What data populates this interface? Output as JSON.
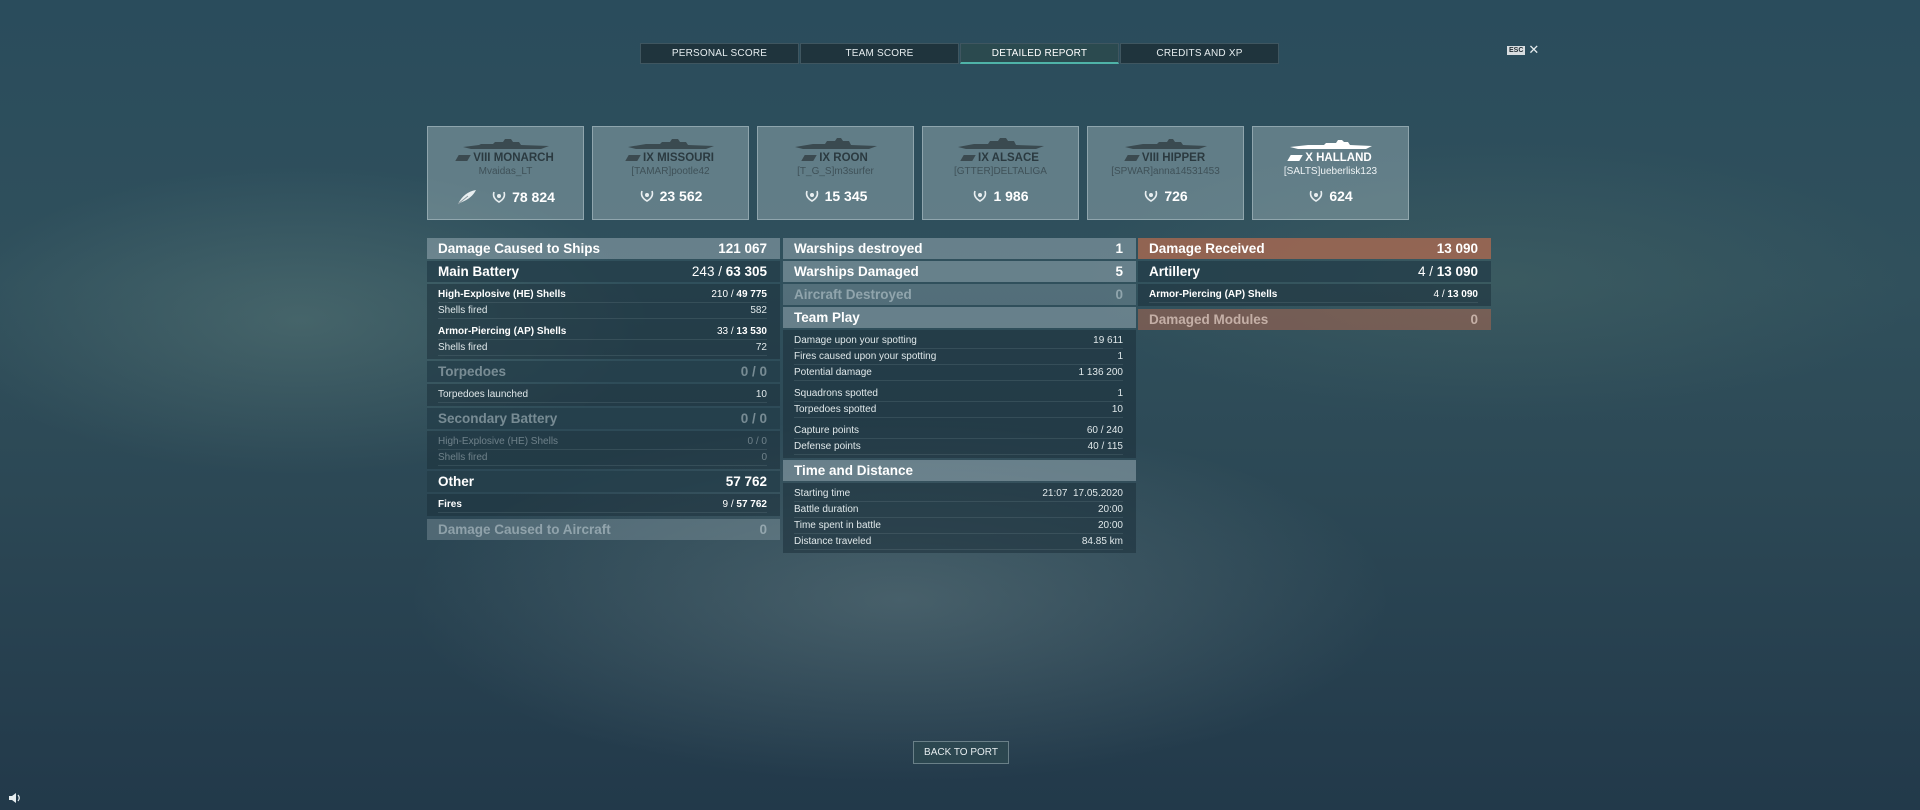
{
  "tabs": [
    {
      "label": "PERSONAL SCORE"
    },
    {
      "label": "TEAM SCORE"
    },
    {
      "label": "DETAILED REPORT"
    },
    {
      "label": "CREDITS AND XP"
    }
  ],
  "esc": {
    "key": "ESC",
    "close": "✕"
  },
  "cards": [
    {
      "ship": "VIII MONARCH",
      "player": "Mvaidas_LT",
      "score": "78 824"
    },
    {
      "ship": "IX MISSOURI",
      "player": "[TAMAR]pootle42",
      "score": "23 562"
    },
    {
      "ship": "IX ROON",
      "player": "[T_G_S]m3surfer",
      "score": "15 345"
    },
    {
      "ship": "IX ALSACE",
      "player": "[GTTER]DELTALIGA",
      "score": "1 986"
    },
    {
      "ship": "VIII HIPPER",
      "player": "[SPWAR]anna14531453",
      "score": "726"
    },
    {
      "ship": "X HALLAND",
      "player": "[SALTS]ueberlisk123",
      "score": "624"
    }
  ],
  "col1": {
    "damage": {
      "label": "Damage Caused to Ships",
      "value": "121 067"
    },
    "main_battery": {
      "label": "Main Battery",
      "hits": "243 / ",
      "total": "63 305"
    },
    "he": {
      "label": "High-Explosive (HE) Shells",
      "hits": "210 / ",
      "total": "49 775",
      "fired_label": "Shells fired",
      "fired": "582"
    },
    "ap": {
      "label": "Armor-Piercing (AP) Shells",
      "hits": "33 / ",
      "total": "13 530",
      "fired_label": "Shells fired",
      "fired": "72"
    },
    "torpedoes": {
      "label": "Torpedoes",
      "value": "0 / 0",
      "launched_label": "Torpedoes launched",
      "launched": "10"
    },
    "secondary": {
      "label": "Secondary Battery",
      "value": "0 / 0",
      "he_label": "High-Explosive (HE) Shells",
      "he_value": "0 / 0",
      "fired_label": "Shells fired",
      "fired": "0"
    },
    "other": {
      "label": "Other",
      "value": "57 762",
      "fires_label": "Fires",
      "fires_hits": "9 / ",
      "fires_total": "57 762"
    },
    "aircraft": {
      "label": "Damage Caused to Aircraft",
      "value": "0"
    }
  },
  "col2": {
    "destroyed": {
      "label": "Warships destroyed",
      "value": "1"
    },
    "damaged": {
      "label": "Warships Damaged",
      "value": "5"
    },
    "aircraft": {
      "label": "Aircraft Destroyed",
      "value": "0"
    },
    "team_play": {
      "label": "Team Play"
    },
    "tp_rows1": [
      {
        "label": "Damage upon your spotting",
        "value": "19 611"
      },
      {
        "label": "Fires caused upon your spotting",
        "value": "1"
      },
      {
        "label": "Potential damage",
        "value": "1 136 200"
      }
    ],
    "tp_rows2": [
      {
        "label": "Squadrons spotted",
        "value": "1"
      },
      {
        "label": "Torpedoes spotted",
        "value": "10"
      }
    ],
    "tp_rows3": [
      {
        "label": "Capture points",
        "value": "60 / 240"
      },
      {
        "label": "Defense points",
        "value": "40 / 115"
      }
    ],
    "time": {
      "label": "Time and Distance"
    },
    "time_rows": [
      {
        "label": "Starting time",
        "value": "21:07  17.05.2020"
      },
      {
        "label": "Battle duration",
        "value": "20:00"
      },
      {
        "label": "Time spent in battle",
        "value": "20:00"
      },
      {
        "label": "Distance traveled",
        "value": "84.85 km"
      }
    ]
  },
  "col3": {
    "received": {
      "label": "Damage Received",
      "value": "13 090"
    },
    "artillery": {
      "label": "Artillery",
      "hits": "4 / ",
      "total": "13 090"
    },
    "ap": {
      "label": "Armor-Piercing (AP) Shells",
      "hits": "4 / ",
      "total": "13 090"
    },
    "modules": {
      "label": "Damaged Modules",
      "value": "0"
    }
  },
  "back_button": "BACK TO PORT",
  "colors": {
    "accent": "#4fb3a8",
    "received": "#aa6950"
  }
}
